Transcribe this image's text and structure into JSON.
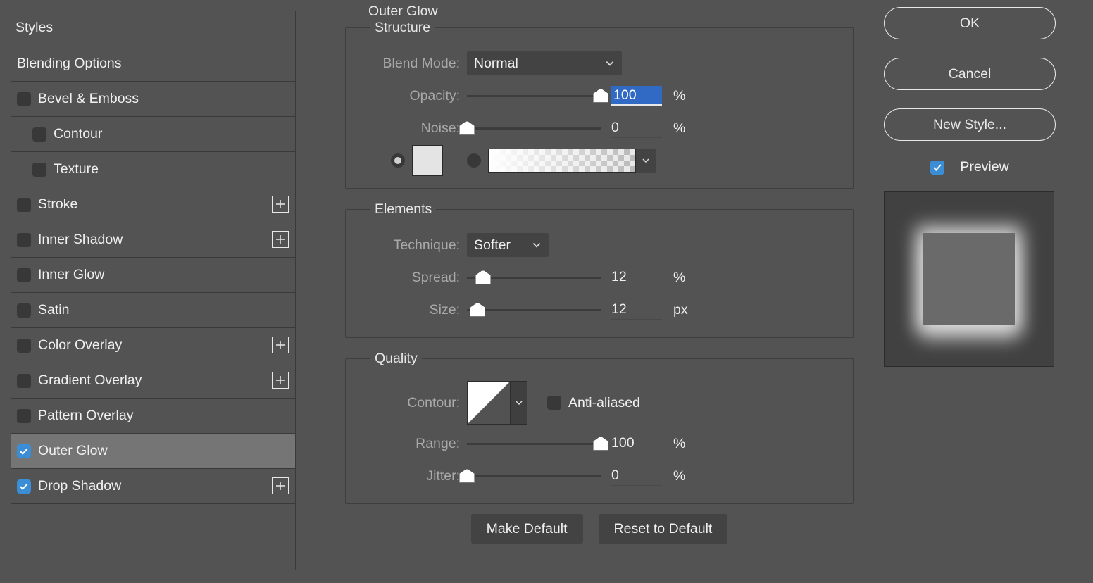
{
  "sidebar": {
    "header": "Styles",
    "blending": "Blending Options",
    "items": [
      {
        "label": "Bevel & Emboss",
        "checked": false,
        "plus": false,
        "sub": false
      },
      {
        "label": "Contour",
        "checked": false,
        "plus": false,
        "sub": true
      },
      {
        "label": "Texture",
        "checked": false,
        "plus": false,
        "sub": true
      },
      {
        "label": "Stroke",
        "checked": false,
        "plus": true,
        "sub": false
      },
      {
        "label": "Inner Shadow",
        "checked": false,
        "plus": true,
        "sub": false
      },
      {
        "label": "Inner Glow",
        "checked": false,
        "plus": false,
        "sub": false
      },
      {
        "label": "Satin",
        "checked": false,
        "plus": false,
        "sub": false
      },
      {
        "label": "Color Overlay",
        "checked": false,
        "plus": true,
        "sub": false
      },
      {
        "label": "Gradient Overlay",
        "checked": false,
        "plus": true,
        "sub": false
      },
      {
        "label": "Pattern Overlay",
        "checked": false,
        "plus": false,
        "sub": false
      },
      {
        "label": "Outer Glow",
        "checked": true,
        "plus": false,
        "sub": false,
        "selected": true
      },
      {
        "label": "Drop Shadow",
        "checked": true,
        "plus": true,
        "sub": false
      }
    ]
  },
  "center": {
    "title": "Outer Glow",
    "structure": {
      "legend": "Structure",
      "blendLabel": "Blend Mode:",
      "blendValue": "Normal",
      "opacityLabel": "Opacity:",
      "opacityValue": "100",
      "opacityUnit": "%",
      "noiseLabel": "Noise:",
      "noiseValue": "0",
      "noiseUnit": "%"
    },
    "elements": {
      "legend": "Elements",
      "techLabel": "Technique:",
      "techValue": "Softer",
      "spreadLabel": "Spread:",
      "spreadValue": "12",
      "spreadUnit": "%",
      "sizeLabel": "Size:",
      "sizeValue": "12",
      "sizeUnit": "px"
    },
    "quality": {
      "legend": "Quality",
      "contourLabel": "Contour:",
      "antiLabel": "Anti-aliased",
      "rangeLabel": "Range:",
      "rangeValue": "100",
      "rangeUnit": "%",
      "jitterLabel": "Jitter:",
      "jitterValue": "0",
      "jitterUnit": "%"
    },
    "makeDefault": "Make Default",
    "resetDefault": "Reset to Default"
  },
  "right": {
    "ok": "OK",
    "cancel": "Cancel",
    "newStyle": "New Style...",
    "preview": "Preview"
  }
}
